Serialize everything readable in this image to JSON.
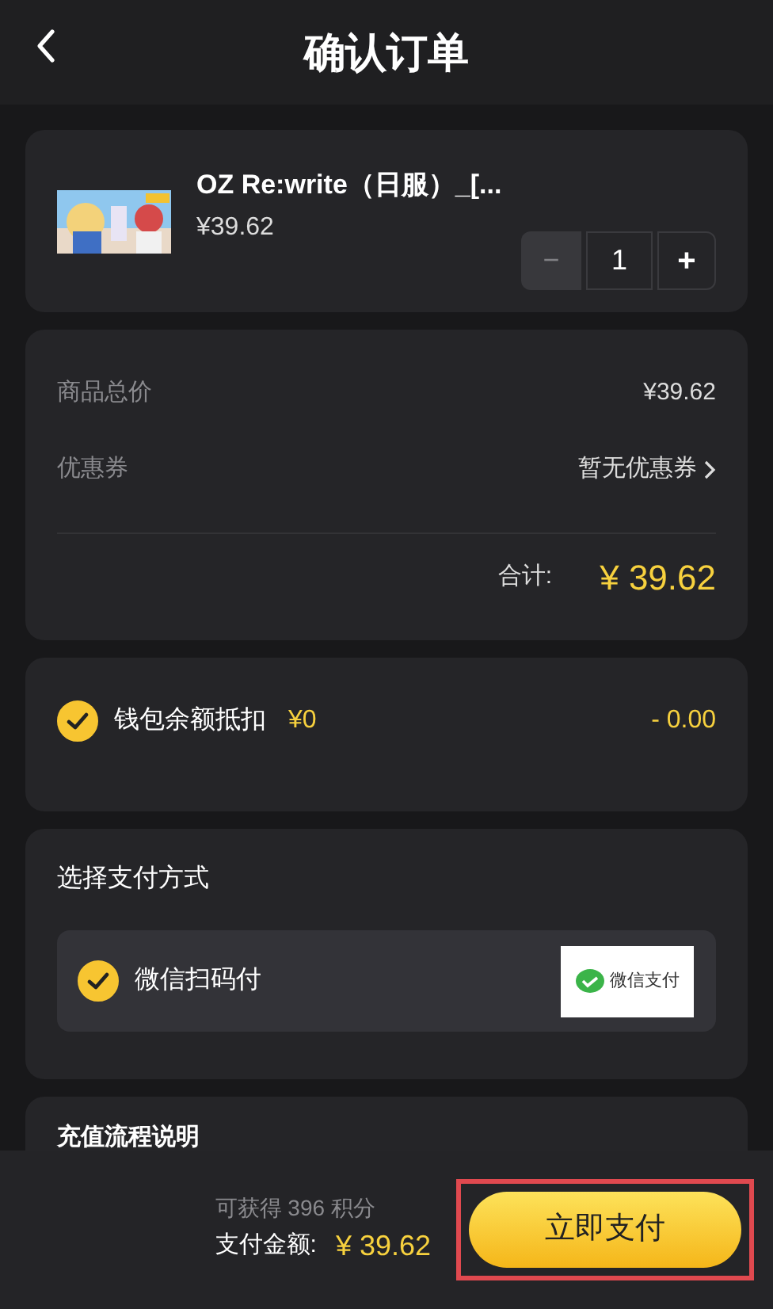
{
  "header": {
    "title": "确认订单"
  },
  "product": {
    "name": "OZ Re:write（日服）_[...",
    "price": "¥39.62",
    "quantity": "1",
    "minus_label": "−",
    "plus_label": "+",
    "minus_disabled": true,
    "plus_disabled": false
  },
  "summary": {
    "rows": [
      {
        "label": "商品总价",
        "value": "¥39.62",
        "link": false
      },
      {
        "label": "优惠券",
        "value": "暂无优惠券",
        "link": true
      }
    ],
    "total_label": "合计:",
    "total_value": "¥ 39.62"
  },
  "wallet": {
    "checked": true,
    "label": "钱包余额抵扣",
    "balance": "¥0",
    "deduction": "- 0.00"
  },
  "payment": {
    "title": "选择支付方式",
    "methods": [
      {
        "label": "微信扫码付",
        "selected": true,
        "logo_text": "微信支付"
      }
    ]
  },
  "notes": {
    "title": "充值流程说明"
  },
  "footer": {
    "points": "可获得 396 积分",
    "amount_label": "支付金额:",
    "amount": "¥ 39.62",
    "pay_button": "立即支付",
    "highlighted": true
  }
}
